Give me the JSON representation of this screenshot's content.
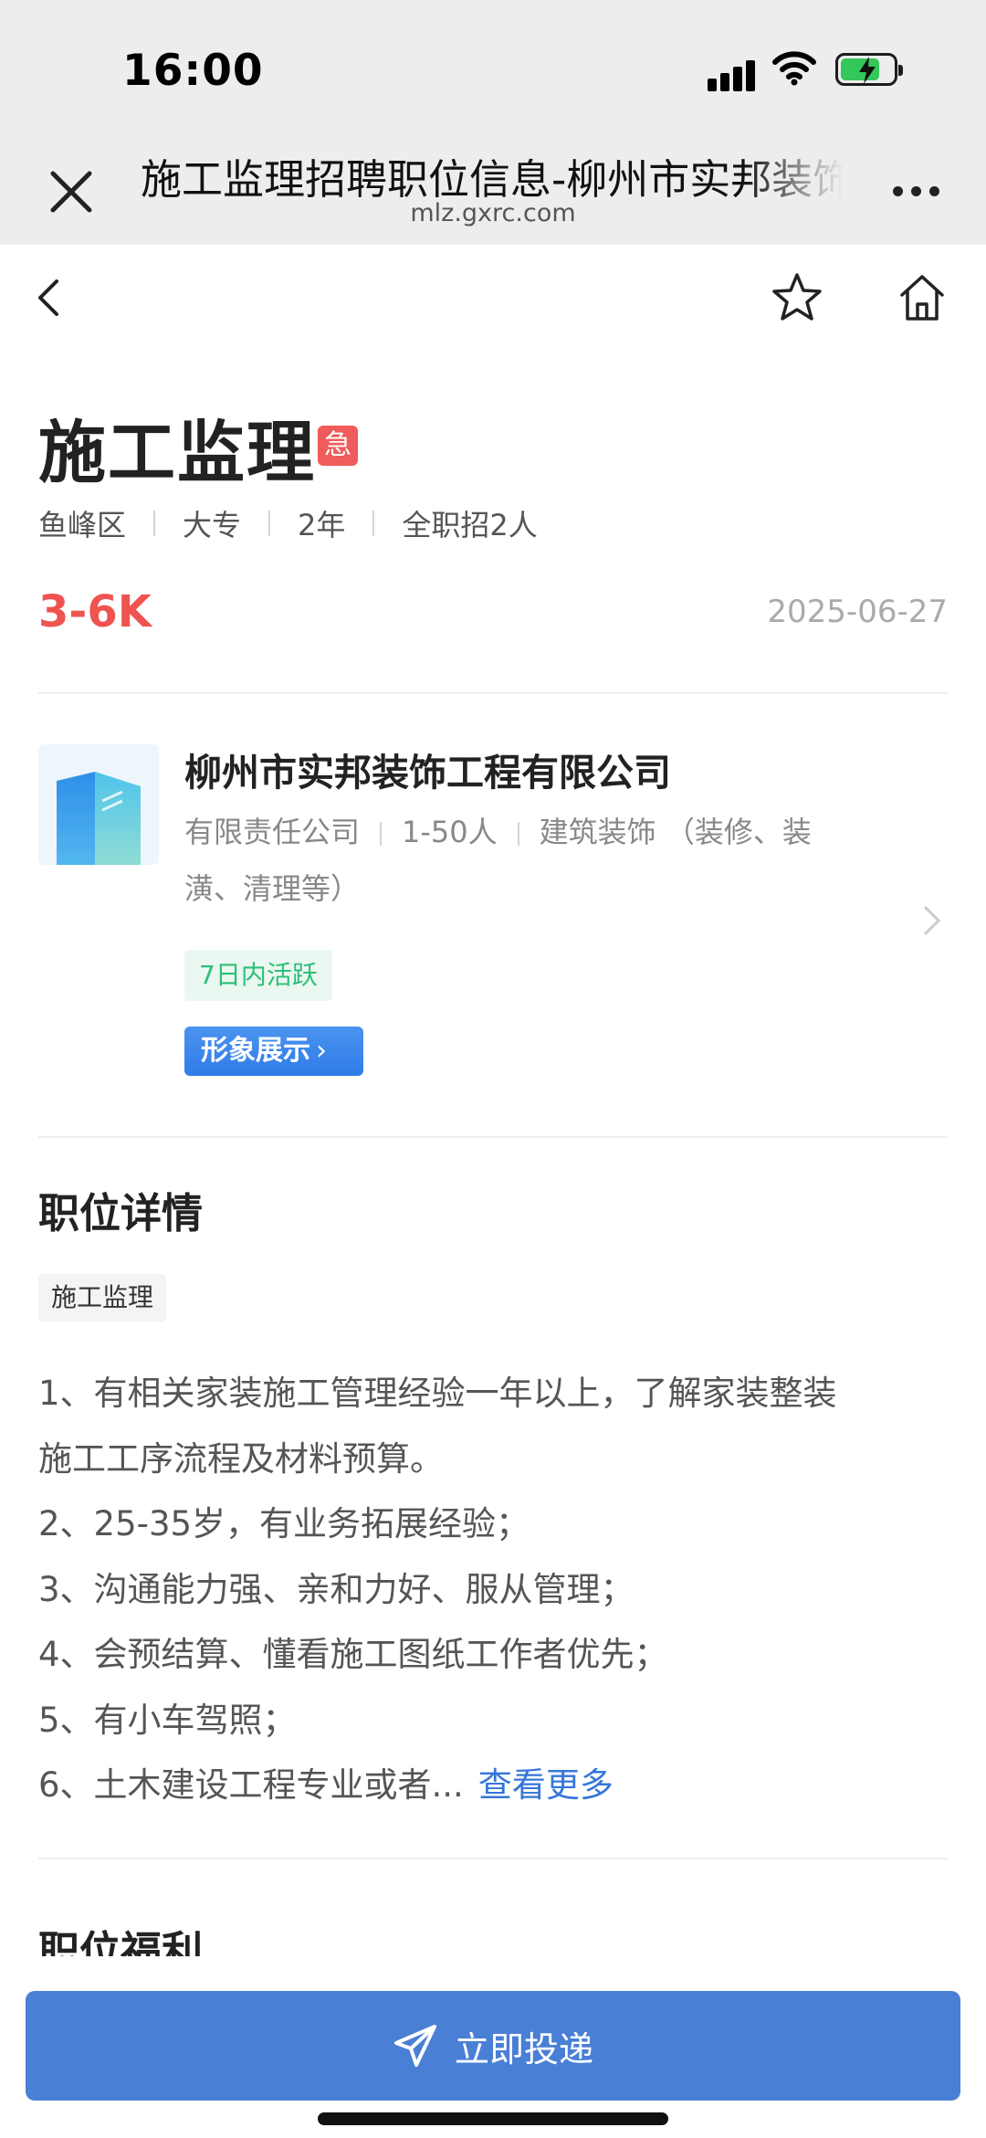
{
  "status_bar": {
    "time": "16:00"
  },
  "browser": {
    "title": "施工监理招聘职位信息-柳州市实邦装饰工程有限公司",
    "domain": "mlz.gxrc.com"
  },
  "job": {
    "title": "施工监理",
    "urgent_badge": "急",
    "meta": [
      "鱼峰区",
      "大专",
      "2年",
      "全职招2人"
    ],
    "salary": "3-6K",
    "date": "2025-06-27"
  },
  "company": {
    "name": "柳州市实邦装饰工程有限公司",
    "type": "有限责任公司",
    "size": "1-50人",
    "industry": "建筑装饰 （装修、装潢、清理等）",
    "active_tag": "7日内活跃",
    "image_button": "形象展示"
  },
  "detail": {
    "section_title": "职位详情",
    "skill_tag": "施工监理",
    "lines": [
      "1、有相关家装施工管理经验一年以上，了解家装整装",
      "施工工序流程及材料预算。",
      "2、25-35岁，有业务拓展经验；",
      "3、沟通能力强、亲和力好、服从管理；",
      "4、会预结算、懂看施工图纸工作者优先；",
      "5、有小车驾照；",
      "6、土木建设工程专业或者..."
    ],
    "see_more": "查看更多"
  },
  "benefits": {
    "section_title": "职位福利"
  },
  "action": {
    "apply_label": "立即投递"
  },
  "colors": {
    "accent": "#4a7fd6",
    "salary": "#ef5350",
    "active": "#2dbf77",
    "urgent": "#f05b5b"
  },
  "icons": [
    "close-icon",
    "more-icon",
    "back-icon",
    "star-icon",
    "home-icon",
    "chevron-right-icon",
    "send-icon"
  ]
}
